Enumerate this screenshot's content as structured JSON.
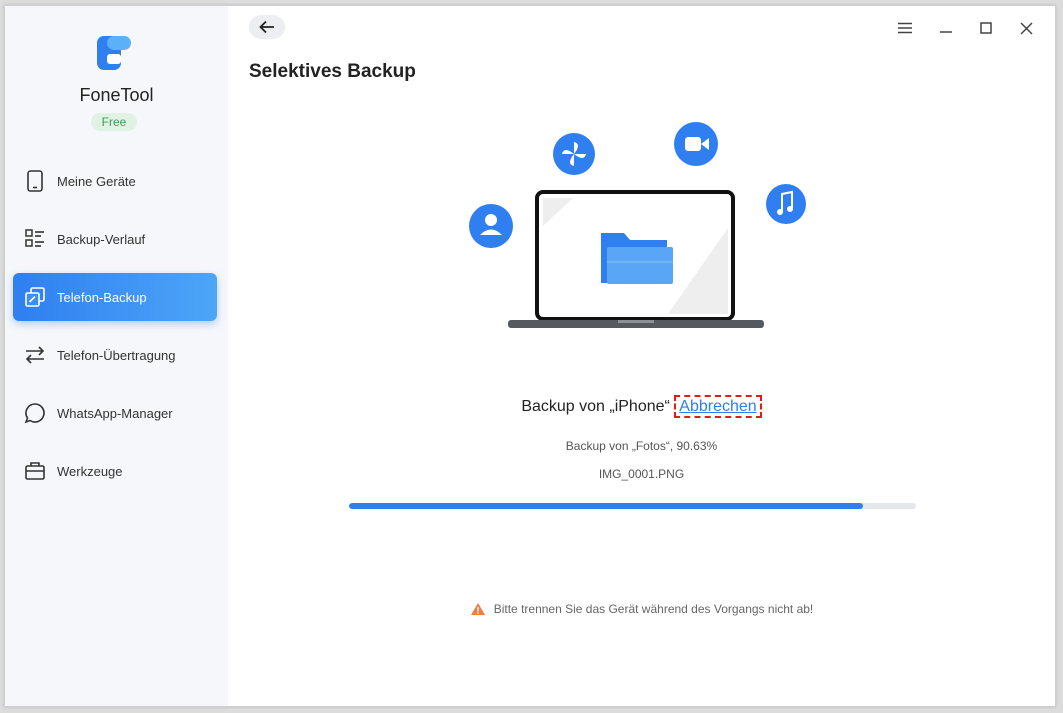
{
  "app": {
    "name": "FoneTool",
    "badge": "Free"
  },
  "sidebar": {
    "items": [
      {
        "label": "Meine Geräte",
        "icon": "phone-icon"
      },
      {
        "label": "Backup-Verlauf",
        "icon": "list-icon"
      },
      {
        "label": "Telefon-Backup",
        "icon": "backup-copy-icon",
        "active": true
      },
      {
        "label": "Telefon-Übertragung",
        "icon": "transfer-arrows-icon"
      },
      {
        "label": "WhatsApp-Manager",
        "icon": "chat-bubble-icon"
      },
      {
        "label": "Werkzeuge",
        "icon": "toolbox-icon"
      }
    ]
  },
  "main": {
    "title": "Selektives Backup",
    "status_prefix": "Backup von „iPhone“",
    "cancel_label": "Abbrechen",
    "sub_status": "Backup von „Fotos“, 90.63%",
    "file_name": "IMG_0001.PNG",
    "progress_percent": 90.63,
    "warning": "Bitte trennen Sie das Gerät während des Vorgangs nicht ab!"
  },
  "colors": {
    "accent": "#2f7ff0",
    "warning_icon": "#f07c3e",
    "cancel_highlight": "#e21b1b"
  }
}
